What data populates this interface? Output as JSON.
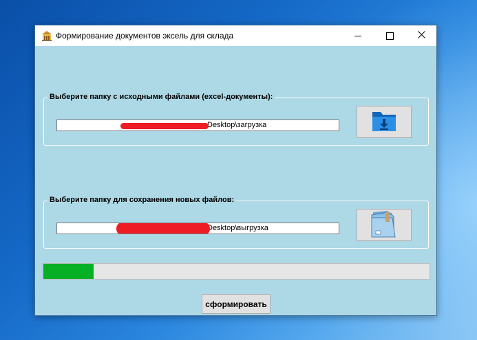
{
  "window": {
    "title": "Формирование документов эксель для склада",
    "app_icon": "building-icon"
  },
  "source_group": {
    "label": "Выберите папку с исходными файлами (excel-документы):",
    "path_value": "Desktop\\загрузка",
    "button_icon": "folder-download-icon"
  },
  "target_group": {
    "label": "Выберите папку для сохранения новых файлов:",
    "path_value": "Desktop\\выгрузка",
    "button_icon": "folder-open-icon"
  },
  "progress": {
    "fraction": 0.13,
    "color": "#06b025"
  },
  "submit_label": "сформировать",
  "colors": {
    "window_bg": "#add8e6",
    "redaction": "#ee1c24"
  }
}
